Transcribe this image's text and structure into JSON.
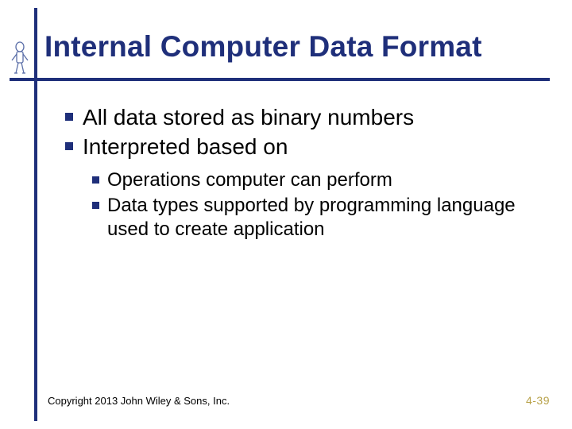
{
  "title": "Internal Computer Data Format",
  "bullets_l1": [
    "All data stored as binary numbers",
    "Interpreted based on"
  ],
  "bullets_l2": [
    "Operations computer can perform",
    "Data types supported by programming language used to create application"
  ],
  "copyright": "Copyright 2013 John Wiley & Sons, Inc.",
  "page_number": "4-39",
  "colors": {
    "accent": "#1f2f7a",
    "pagenum": "#b8a24a"
  }
}
